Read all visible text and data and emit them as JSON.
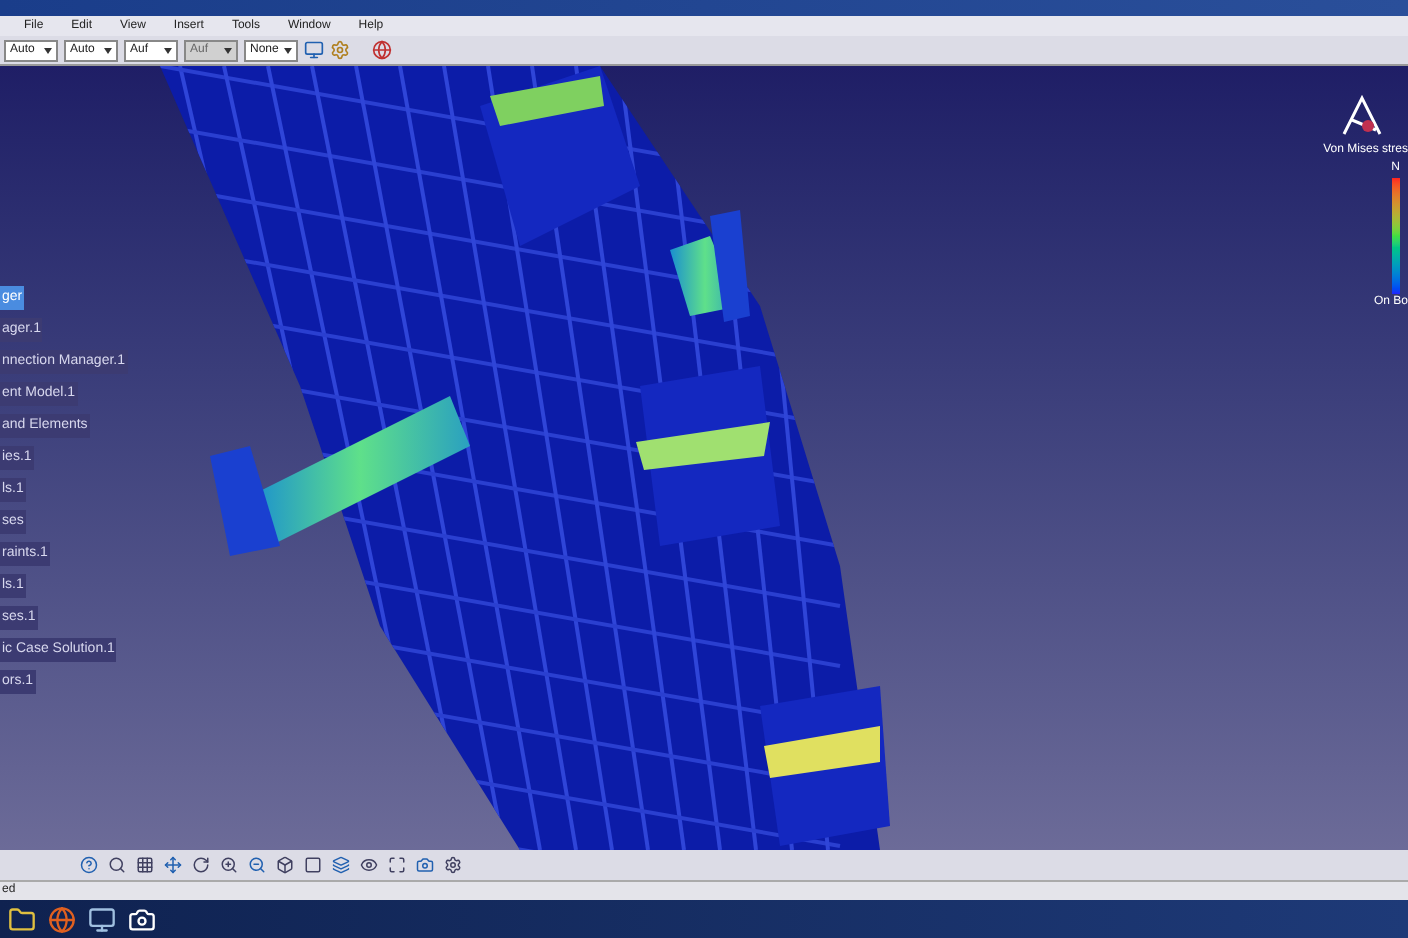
{
  "menu_bar": {
    "items": [
      "File",
      "Edit",
      "View",
      "Insert",
      "Tools",
      "Window",
      "Help"
    ]
  },
  "toolbar": {
    "dropdowns": [
      {
        "value": "Auto",
        "disabled": false
      },
      {
        "value": "Auto",
        "disabled": false
      },
      {
        "value": "Auf",
        "disabled": false
      },
      {
        "value": "Auf",
        "disabled": true
      },
      {
        "value": "None",
        "disabled": false
      }
    ]
  },
  "tree": {
    "items": [
      {
        "label": "ger",
        "selected": true
      },
      {
        "label": "ager.1",
        "selected": false
      },
      {
        "label": "nnection Manager.1",
        "selected": false
      },
      {
        "label": "ent Model.1",
        "selected": false
      },
      {
        "label": "and Elements",
        "selected": false
      },
      {
        "label": "ies.1",
        "selected": false
      },
      {
        "label": "ls.1",
        "selected": false
      },
      {
        "label": "ses",
        "selected": false
      },
      {
        "label": "raints.1",
        "selected": false
      },
      {
        "label": "ls.1",
        "selected": false
      },
      {
        "label": "ses.1",
        "selected": false
      },
      {
        "label": "ic Case Solution.1",
        "selected": false
      },
      {
        "label": "ors.1",
        "selected": false
      }
    ]
  },
  "legend": {
    "title": "Von Mises stres",
    "unit": "N",
    "footer": "On Bo"
  },
  "status_bar": {
    "text": "ed"
  }
}
